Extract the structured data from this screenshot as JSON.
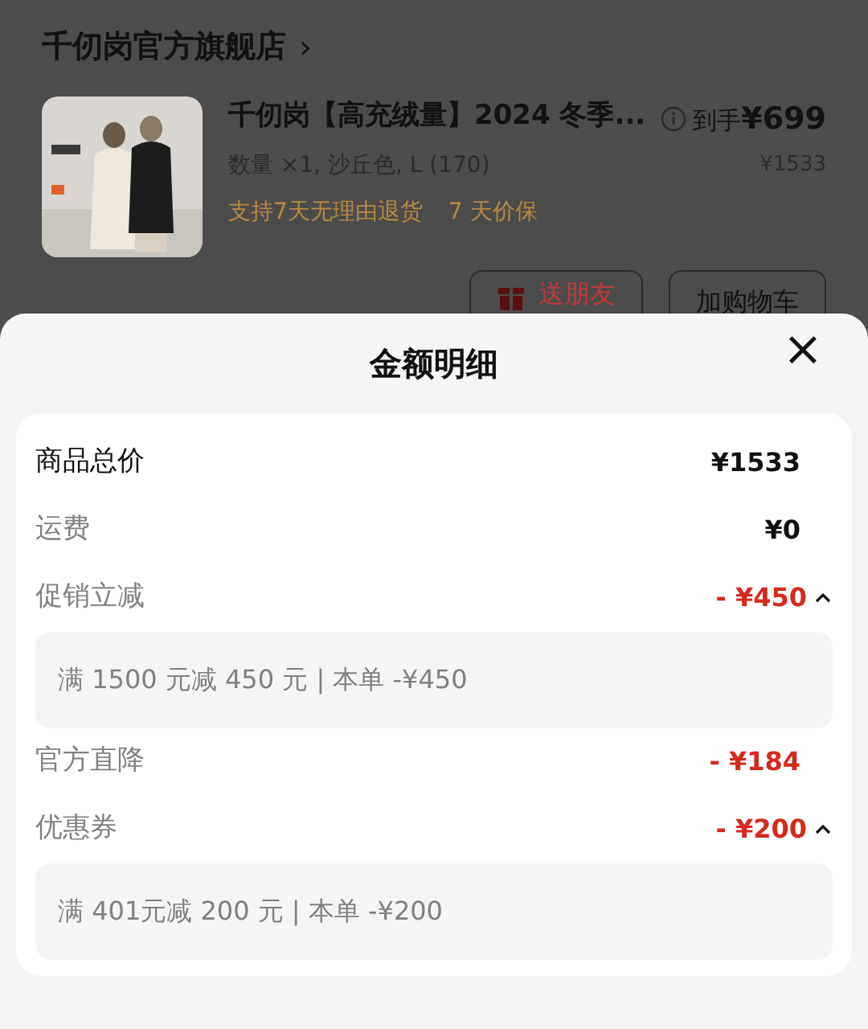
{
  "store": {
    "name": "千仞岗官方旗舰店",
    "arrow": "›"
  },
  "product": {
    "title": "千仞岗【高充绒量】2024 冬季...",
    "spec": "数量 ×1, 沙丘色, L (170)",
    "services": [
      "支持7天无理由退货",
      "7 天价保"
    ],
    "price_label": "到手",
    "price": "¥699",
    "original_price": "¥1533"
  },
  "buttons": [
    "送朋友",
    "加购物车"
  ],
  "sheet": {
    "title": "金额明细",
    "close": "×",
    "rows": [
      {
        "kind": "total",
        "label": "商品总价",
        "value": "¥1533"
      },
      {
        "kind": "fee",
        "label": "运费",
        "value": "¥0"
      },
      {
        "kind": "discount",
        "label": "促销立减",
        "value": "- ¥450",
        "expanded": true,
        "detail": "满 1500 元减 450 元 | 本单 -¥450"
      },
      {
        "kind": "discount",
        "label": "官方直降",
        "value": "- ¥184"
      },
      {
        "kind": "discount",
        "label": "优惠券",
        "value": "- ¥200",
        "expanded": true,
        "detail": "满 401元减 200 元 | 本单 -¥200"
      }
    ]
  }
}
